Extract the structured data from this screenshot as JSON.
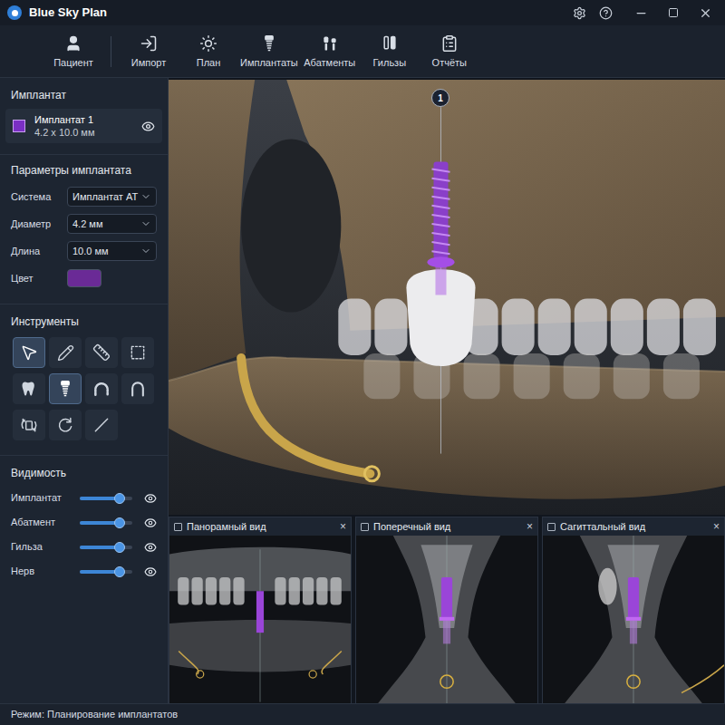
{
  "window": {
    "title": "Blue Sky Plan"
  },
  "toolbar": [
    {
      "label": "Пациент",
      "kind": "patient",
      "selected": false
    },
    {
      "label": "Импорт",
      "kind": "import",
      "selected": false
    },
    {
      "label": "План",
      "kind": "plan",
      "selected": false
    },
    {
      "label": "Имплантаты",
      "kind": "implants",
      "selected": false
    },
    {
      "label": "Абатменты",
      "kind": "abutments",
      "selected": false
    },
    {
      "label": "Гильзы",
      "kind": "sleeves",
      "selected": false
    },
    {
      "label": "Отчёты",
      "kind": "reports",
      "selected": false
    }
  ],
  "implant_panel": {
    "title": "Имплантат",
    "item": {
      "name": "Имплантат 1",
      "size": "4.2 x 10.0 мм",
      "color": "#7a2fc4",
      "visible": true
    }
  },
  "params": {
    "title": "Параметры имплантата",
    "fields": [
      {
        "label": "Система",
        "kind": "select",
        "value": "Имплантат АТ"
      },
      {
        "label": "Диаметр",
        "kind": "select",
        "value": "4.2 мм"
      },
      {
        "label": "Длина",
        "kind": "select",
        "value": "10.0 мм"
      },
      {
        "label": "Цвет",
        "kind": "color",
        "color": "#6a2a96"
      }
    ]
  },
  "tools": {
    "title": "Инструменты",
    "items": [
      {
        "kind": "cursor",
        "selected": true
      },
      {
        "kind": "pencil",
        "selected": false
      },
      {
        "kind": "ruler",
        "selected": false
      },
      {
        "kind": "select",
        "selected": false
      },
      {
        "kind": "tooth",
        "selected": false
      },
      {
        "kind": "implant",
        "selected": true
      },
      {
        "kind": "arch",
        "selected": false
      },
      {
        "kind": "u-arch",
        "selected": false
      },
      {
        "kind": "rotate",
        "selected": false
      },
      {
        "kind": "circle",
        "selected": false
      },
      {
        "kind": "line",
        "selected": false
      }
    ]
  },
  "visibility": {
    "title": "Видимость",
    "items": [
      {
        "label": "Имплантат",
        "level": 0.75,
        "visible": true
      },
      {
        "label": "Абатмент",
        "level": 0.75,
        "visible": true
      },
      {
        "label": "Гильза",
        "level": 0.75,
        "visible": true
      },
      {
        "label": "Нерв",
        "level": 0.75,
        "visible": true
      }
    ]
  },
  "viewport": {
    "marker": "1"
  },
  "views": [
    {
      "title": "Панорамный вид",
      "kind": "panoramic",
      "close": "×"
    },
    {
      "title": "Поперечный вид",
      "kind": "cross",
      "close": "×"
    },
    {
      "title": "Сагиттальный вид",
      "kind": "sagittal",
      "close": "×"
    }
  ],
  "status_bar": {
    "text": "Режим: Планирование имплантатов"
  }
}
